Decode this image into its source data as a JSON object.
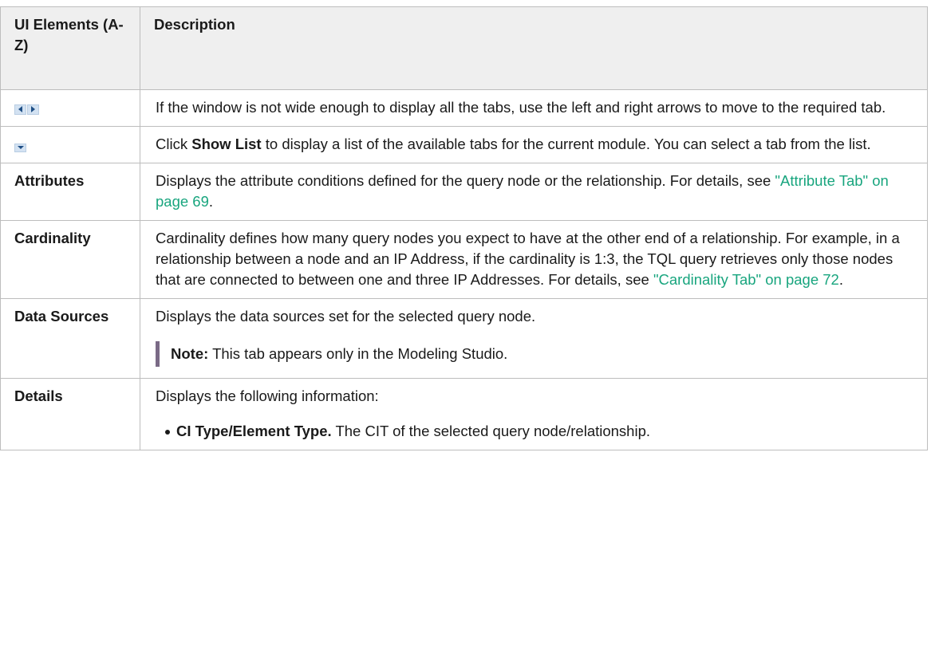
{
  "header": {
    "col1": "UI Elements (A-Z)",
    "col2": "Description"
  },
  "rows": {
    "arrows": {
      "icon": "left-right-scroll-arrows-icon",
      "description": "If the window is not wide enough to display all the tabs, use the left and right arrows to move to the required tab."
    },
    "showlist": {
      "icon": "show-list-dropdown-icon",
      "desc_pre": "Click ",
      "desc_bold": "Show List",
      "desc_post": " to display a list of the available tabs for the current module. You can select a tab from the list."
    },
    "attributes": {
      "term": "Attributes",
      "desc_pre": "Displays the attribute conditions defined for the query node or the relationship. For details, see ",
      "link": "\"Attribute Tab\" on page 69",
      "desc_post": "."
    },
    "cardinality": {
      "term": "Cardinality",
      "desc_pre": "Cardinality defines how many query nodes you expect to have at the other end of a relationship. For example, in a relationship between a node and an IP Address, if the cardinality is 1:3, the TQL query retrieves only those nodes that are connected to between one and three IP Addresses. For details, see ",
      "link": "\"Cardinality Tab\" on page 72",
      "desc_post": "."
    },
    "datasources": {
      "term": "Data Sources",
      "description": "Displays the data sources set for the selected query node.",
      "note_label": "Note:",
      "note_text": " This tab appears only in the Modeling Studio."
    },
    "details": {
      "term": "Details",
      "description": "Displays the following information:",
      "items": [
        {
          "bold": "CI Type/Element Type.",
          "text": " The CIT of the selected query node/relationship."
        }
      ]
    }
  },
  "colors": {
    "link": "#18a57e",
    "header_bg": "#efefef",
    "border": "#bdbdbd",
    "note_bar": "#7a6a86",
    "icon_bg": "#d3e2f2",
    "icon_arrow": "#1f4f86"
  }
}
